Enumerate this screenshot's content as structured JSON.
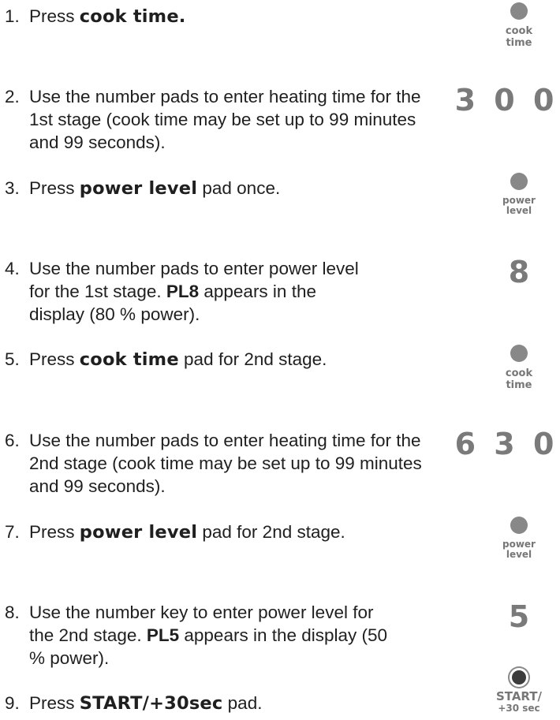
{
  "steps": [
    {
      "num": "1.",
      "pre": "Press ",
      "kw": "cook time.",
      "post": ""
    },
    {
      "num": "2.",
      "text": "Use the number pads to enter heating time for the 1st stage (cook time may be set up to 99 minutes and 99 seconds)."
    },
    {
      "num": "3.",
      "pre": "Press ",
      "kw": "power level",
      "post": " pad once."
    },
    {
      "num": "4.",
      "pre": "Use the number pads to enter power level for the 1st stage. ",
      "bold": "PL8",
      "post": " appears in the display (80 % power)."
    },
    {
      "num": "5.",
      "pre": "Press ",
      "kw": "cook time",
      "post": " pad for 2nd stage."
    },
    {
      "num": "6.",
      "text": "Use the number pads to enter heating time for the 2nd stage (cook time may be set up to 99 minutes and 99 seconds)."
    },
    {
      "num": "7.",
      "pre": "Press ",
      "kw": "power level",
      "post": " pad for 2nd stage."
    },
    {
      "num": "8.",
      "pre": "Use the number key to enter power level for the 2nd stage. ",
      "bold": "PL5",
      "post": " appears in the display (50 % power)."
    },
    {
      "num": "9.",
      "pre": "Press ",
      "kw": "START/+30sec",
      "post": " pad."
    }
  ],
  "pads": {
    "cook_time_1": {
      "line1": "cook",
      "line2": "time"
    },
    "power_level_1": {
      "line1": "power",
      "line2": "level"
    },
    "cook_time_2": {
      "line1": "cook",
      "line2": "time"
    },
    "power_level_2": {
      "line1": "power",
      "line2": "level"
    },
    "start": {
      "line1": "START/",
      "line2": "+30 sec"
    }
  },
  "displays": {
    "time_1": "3 0 0",
    "level_1": "8",
    "time_2": "6 3 0",
    "level_2": "5"
  },
  "colors": {
    "text": "#1f1f1f",
    "pad_gray": "#888888",
    "pad_label": "#777777"
  }
}
